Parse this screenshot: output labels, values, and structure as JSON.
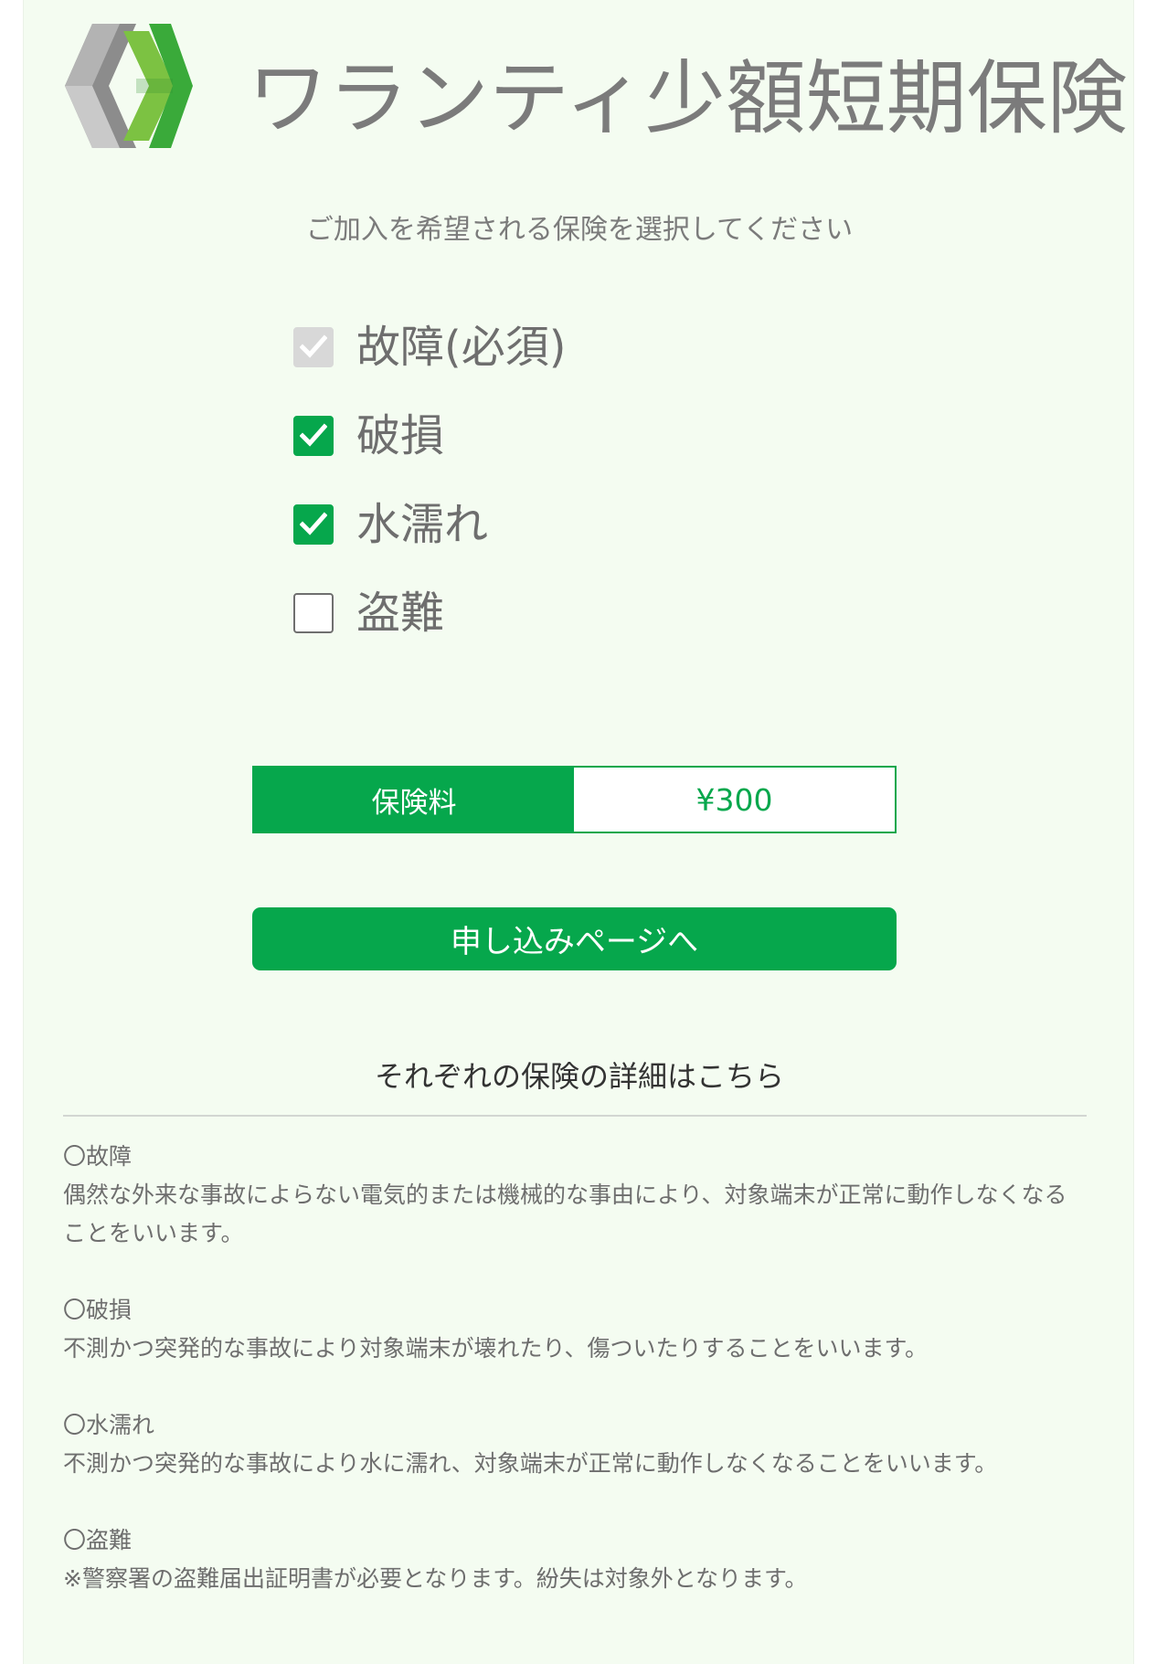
{
  "header": {
    "brand_name": "ワランティ少額短期保険",
    "colors": {
      "logo_gray": "#8c8c8c",
      "logo_green": "#3aaa3a",
      "logo_light_green": "#7cc242"
    }
  },
  "instruction": "ご加入を希望される保険を選択してください",
  "options": [
    {
      "label": "故障(必須)",
      "state": "checked-disabled"
    },
    {
      "label": "破損",
      "state": "checked"
    },
    {
      "label": "水濡れ",
      "state": "checked"
    },
    {
      "label": "盗難",
      "state": "unchecked"
    }
  ],
  "premium": {
    "label": "保険料",
    "value": "¥300"
  },
  "apply_button": {
    "label": "申し込みページへ"
  },
  "details": {
    "heading": "それぞれの保険の詳細はこちら",
    "items": [
      {
        "title": "〇故障",
        "text": "偶然な外来な事故によらない電気的または機械的な事由により、対象端末が正常に動作しなくなることをいいます。"
      },
      {
        "title": "〇破損",
        "text": "不測かつ突発的な事故により対象端末が壊れたり、傷ついたりすることをいいます。"
      },
      {
        "title": "〇水濡れ",
        "text": "不測かつ突発的な事故により水に濡れ、対象端末が正常に動作しなくなることをいいます。"
      },
      {
        "title": "〇盗難",
        "text": "※警察署の盗難届出証明書が必要となります。紛失は対象外となります。"
      }
    ]
  },
  "theme": {
    "accent": "#06a74c",
    "background": "#f4fcf1",
    "text_gray": "#6e6e6e"
  }
}
